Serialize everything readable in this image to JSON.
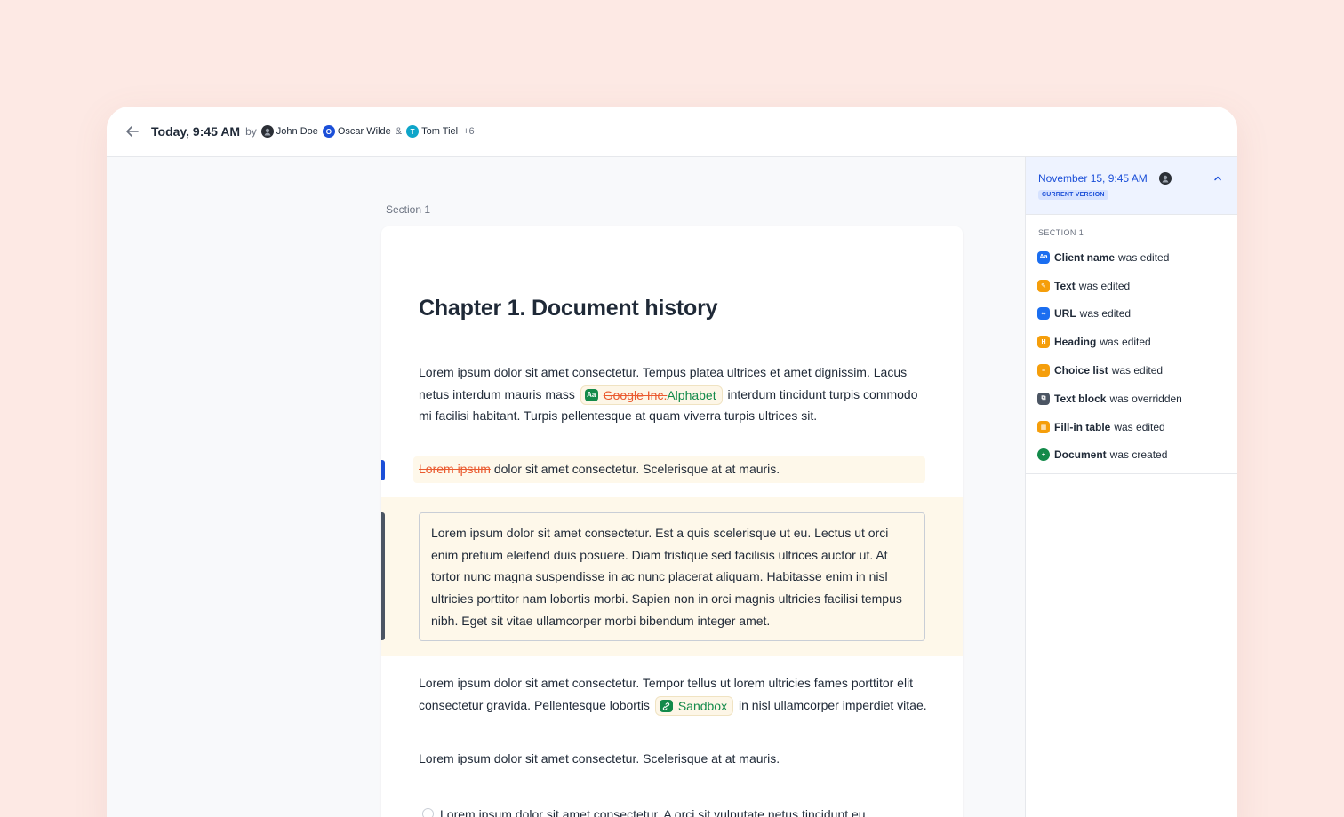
{
  "header": {
    "title": "Today, 9:45 AM",
    "by": "by",
    "authors": [
      "John Doe",
      "Oscar Wilde",
      "Tom Tiel"
    ],
    "author_initials": [
      "",
      "O",
      "T"
    ],
    "ampersand": "&",
    "more_count": "+6"
  },
  "document": {
    "section_label": "Section 1",
    "heading": "Chapter 1. Document history",
    "p1_before": "Lorem ipsum dolor sit amet consectetur. Tempus platea ultrices et amet dignissim. Lacus netus interdum mauris mass",
    "p1_chip_icon": "Aa",
    "p1_deleted": "Google Inc.",
    "p1_inserted": "Alphabet",
    "p1_after": "interdum tincidunt turpis commodo mi facilisi habitant. Turpis pellentesque at quam viverra turpis ultrices sit.",
    "p2_deleted": "Lorem ipsum",
    "p2_after": "dolor sit amet consectetur. Scelerisque at at mauris.",
    "block_text": "Lorem ipsum dolor sit amet consectetur. Est a quis scelerisque ut eu. Lectus ut orci enim pretium eleifend duis posuere. Diam tristique sed facilisis ultrices auctor ut. At tortor nunc magna suspendisse in ac nunc placerat aliquam. Habitasse enim in nisl ultricies porttitor nam lobortis morbi. Sapien non in orci magnis ultricies facilisi tempus nibh. Eget sit vitae ullamcorper morbi bibendum integer amet.",
    "p3_before": "Lorem ipsum dolor sit amet consectetur. Tempor tellus ut lorem ultricies fames porttitor elit consectetur gravida. Pellentesque lobortis",
    "p3_link": "Sandbox",
    "p3_after": "in nisl ullamcorper imperdiet vitae.",
    "p4": "Lorem ipsum dolor sit amet consectetur. Scelerisque at at mauris.",
    "p5": "Lorem ipsum dolor sit amet consectetur. A orci sit vulputate netus tincidunt eu"
  },
  "side_panel": {
    "version_date": "November 15, 9:45 AM",
    "current_badge": "CURRENT VERSION",
    "section_label": "SECTION 1",
    "changes": [
      {
        "name": "Client name",
        "action": "was edited",
        "icon": "text-format-icon",
        "glyph": "Aa"
      },
      {
        "name": "Text",
        "action": "was edited",
        "icon": "pencil-icon",
        "glyph": "✎"
      },
      {
        "name": "URL",
        "action": "was edited",
        "icon": "link-icon",
        "glyph": "∞"
      },
      {
        "name": "Heading",
        "action": "was edited",
        "icon": "heading-icon",
        "glyph": "H"
      },
      {
        "name": "Choice list",
        "action": "was edited",
        "icon": "choice-list-icon",
        "glyph": "≡"
      },
      {
        "name": "Text block",
        "action": "was overridden",
        "icon": "override-icon",
        "glyph": "⧉"
      },
      {
        "name": "Fill-in table",
        "action": "was edited",
        "icon": "table-icon",
        "glyph": "▦"
      },
      {
        "name": "Document",
        "action": "was created",
        "icon": "plus-circle-icon",
        "glyph": "+"
      }
    ]
  },
  "colors": {
    "background": "#fde9e4",
    "accent_blue": "#1b4fd8",
    "insert_green": "#138a4a",
    "delete_red": "#ea5a2f",
    "highlight": "#fef8ea"
  }
}
